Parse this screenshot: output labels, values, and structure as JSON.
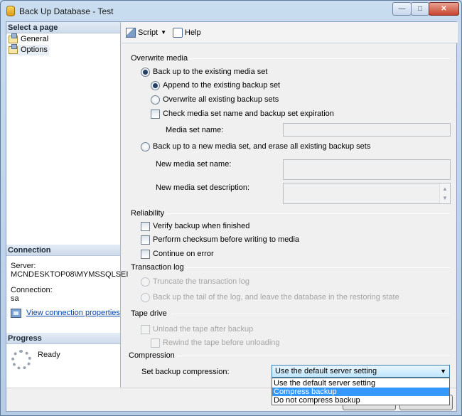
{
  "window": {
    "title": "Back Up Database - Test"
  },
  "sidebar": {
    "select_header": "Select a page",
    "pages": [
      {
        "label": "General"
      },
      {
        "label": "Options",
        "selected": true
      }
    ],
    "connection_header": "Connection",
    "server_label": "Server:",
    "server_value": "MCNDESKTOP08\\MYMSSQLSEI",
    "connection_label": "Connection:",
    "connection_value": "sa",
    "view_conn_link": "View connection properties",
    "progress_header": "Progress",
    "progress_status": "Ready"
  },
  "toolbar": {
    "script_label": "Script",
    "help_label": "Help"
  },
  "overwrite_media": {
    "title": "Overwrite media",
    "backup_existing": "Back up to the existing media set",
    "append": "Append to the existing backup set",
    "overwrite_all": "Overwrite all existing backup sets",
    "check_name": "Check media set name and backup set expiration",
    "media_set_name_label": "Media set name:",
    "backup_new": "Back up to a new media set, and erase all existing backup sets",
    "new_media_name_label": "New media set name:",
    "new_media_desc_label": "New media set description:"
  },
  "reliability": {
    "title": "Reliability",
    "verify": "Verify backup when finished",
    "checksum": "Perform checksum before writing to media",
    "continue_on_error": "Continue on error"
  },
  "transaction_log": {
    "title": "Transaction log",
    "truncate": "Truncate the transaction log",
    "tail": "Back up the tail of the log, and leave the database in the restoring state"
  },
  "tape_drive": {
    "title": "Tape drive",
    "unload": "Unload the tape after backup",
    "rewind": "Rewind the tape before unloading"
  },
  "compression": {
    "title": "Compression",
    "set_label": "Set backup compression:",
    "selected": "Use the default server setting",
    "options": [
      "Use the default server setting",
      "Compress backup",
      "Do not compress backup"
    ],
    "highlighted_index": 1
  },
  "colors": {
    "highlight": "#3399ff",
    "link": "#0645ad"
  }
}
